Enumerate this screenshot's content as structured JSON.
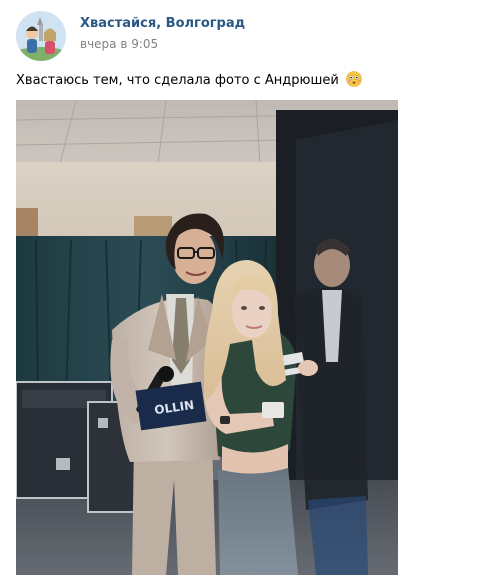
{
  "post": {
    "author": "Хвастайся, Волгоград",
    "time": "вчера в 9:05",
    "text": "Хвастаюсь тем, что сделала фото с Андрюшей",
    "emoji": "flushed-face-emoji",
    "avatar_icon": "group-avatar-icon",
    "photo": {
      "icon": "post-photo",
      "mic_flag_text": "OLLIN"
    }
  },
  "colors": {
    "link": "#2a5885",
    "meta": "#828282"
  }
}
